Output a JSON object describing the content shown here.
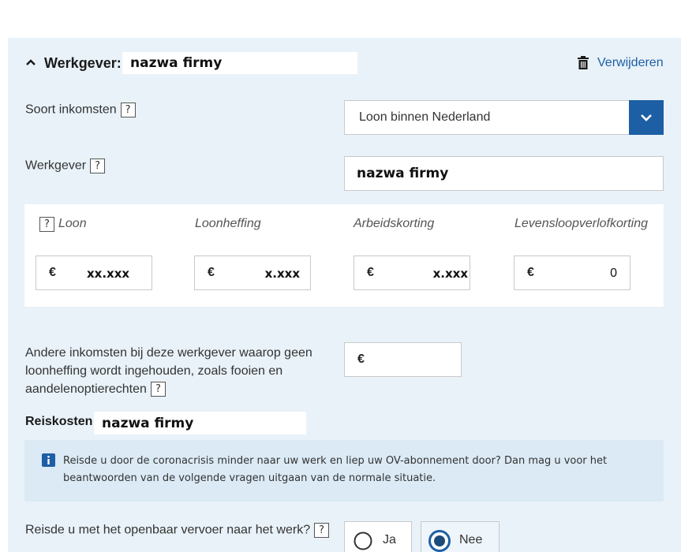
{
  "header": {
    "title": "Werkgever:",
    "employer_name": "nazwa firmy",
    "remove_label": "Verwijderen"
  },
  "income_type": {
    "label": "Soort inkomsten",
    "help": "?",
    "selected": "Loon binnen Nederland"
  },
  "employer": {
    "label": "Werkgever",
    "help": "?",
    "value": "nazwa firmy"
  },
  "wages": {
    "help": "?",
    "columns": [
      {
        "label": "Loon",
        "value": "xx.xxx"
      },
      {
        "label": "Loonheffing",
        "value": "x.xxx"
      },
      {
        "label": "Arbeidskorting",
        "value": "x.xxx"
      },
      {
        "label": "Levensloopverlofkorting",
        "value": "0"
      }
    ],
    "currency": "€"
  },
  "other_income": {
    "label_line1": "Andere inkomsten bij deze werkgever waarop geen",
    "label_line2": "loonheffing wordt ingehouden, zoals fooien en",
    "label_line3": "aandelenoptierechten",
    "help": "?",
    "currency": "€"
  },
  "travel": {
    "label": "Reiskosten",
    "employer_name": "nazwa firmy"
  },
  "info": {
    "line1": "Reisde u door de coronacrisis minder naar uw werk en liep uw OV-abonnement door? Dan mag u voor het",
    "line2": "beantwoorden van de volgende vragen uitgaan van de normale situatie."
  },
  "public_transport": {
    "question": "Reisde u met het openbaar vervoer naar het werk?",
    "help": "?",
    "options": [
      {
        "label": "Ja",
        "selected": false
      },
      {
        "label": "Nee",
        "selected": true
      }
    ]
  },
  "colors": {
    "accent": "#1d5fa4",
    "panel": "#e9f2f9",
    "info_bg": "#dbeaf5"
  }
}
